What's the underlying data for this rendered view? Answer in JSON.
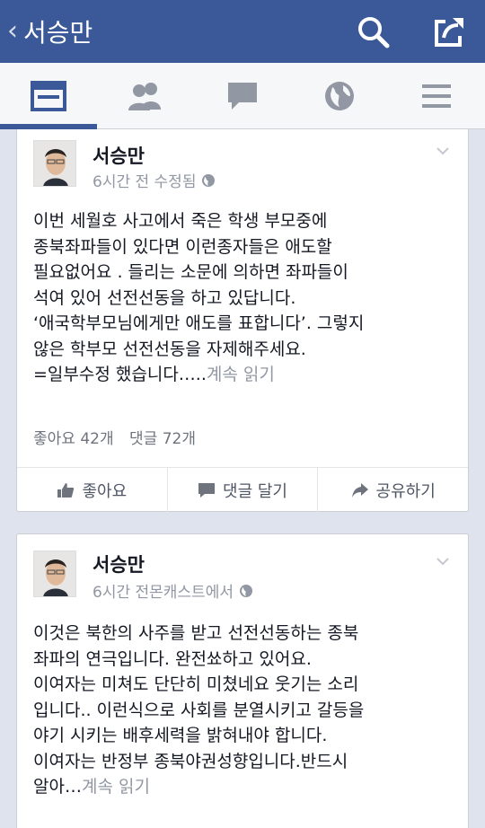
{
  "header": {
    "back_chevron": "‹",
    "title": "서승만"
  },
  "tabs": [
    {
      "name": "news-feed",
      "active": true
    },
    {
      "name": "friends",
      "active": false
    },
    {
      "name": "messages",
      "active": false
    },
    {
      "name": "notifications",
      "active": false
    },
    {
      "name": "menu",
      "active": false
    }
  ],
  "colors": {
    "brand": "#3b5998",
    "text": "#141823",
    "muted": "#9197a3"
  },
  "posts": [
    {
      "author": "서승만",
      "meta": "6시간 전 수정됨",
      "lines": [
        "이번 세월호 사고에서 죽은 학생 부모중에",
        "종북좌파들이 있다면 이런종자들은 애도할",
        "필요없어요 . 들리는 소문에 의하면 좌파들이",
        "석여 있어 선전선동을 하고 있답니다.",
        "‘애국학부모님에게만 애도를 표합니다’. 그렇지",
        "않은 학부모 선전선동을  자제해주세요.",
        "=일부수정 했습니다….."
      ],
      "more": "계속 읽기",
      "likes": "좋아요 42개",
      "comments": "댓글 72개",
      "actions": {
        "like": "좋아요",
        "comment": "댓글 달기",
        "share": "공유하기"
      }
    },
    {
      "author": "서승만",
      "meta": "6시간 전몬캐스트에서",
      "lines": [
        "이것은 북한의 사주를 받고 선전선동하는 종북",
        "좌파의 연극입니다. 완전쑈하고 있어요.",
        "이여자는 미쳐도 단단히 미쳤네요  웃기는 소리",
        "입니다.. 이런식으로 사회를 분열시키고 갈등을",
        "야기 시키는  배후세력을 밝혀내야 합니다.",
        "이여자는 반정부 종북야권성향입니다.반드시",
        "알아…"
      ],
      "more": "계속 읽기"
    }
  ]
}
